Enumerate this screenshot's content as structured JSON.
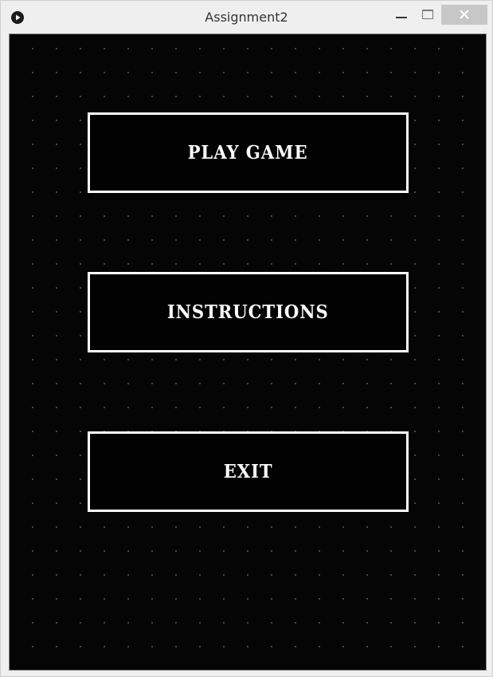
{
  "window": {
    "title": "Assignment2",
    "icons": {
      "app": "play-circle-icon",
      "minimize": "minimize-icon",
      "maximize": "maximize-icon",
      "close": "close-icon"
    }
  },
  "menu": {
    "play_label": "PLAY GAME",
    "instructions_label": "INSTRUCTIONS",
    "exit_label": "EXIT"
  },
  "colors": {
    "background": "#050505",
    "button_border": "#ffffff",
    "button_text": "#ffffff",
    "dot_grid": "#4a5a4a",
    "titlebar": "#efefef",
    "close_button": "#c7c7c7"
  }
}
